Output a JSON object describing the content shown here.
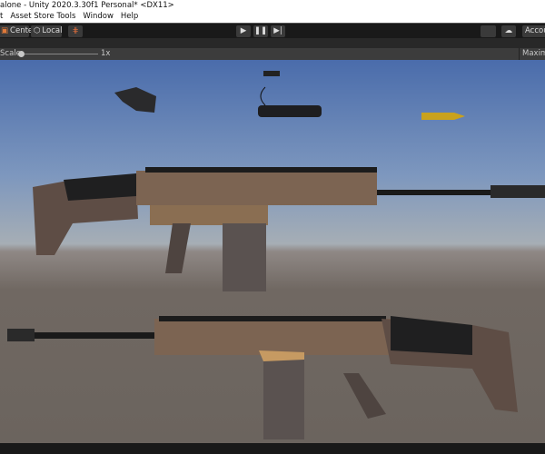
{
  "window": {
    "title": "alone - Unity 2020.3.30f1 Personal* <DX11>"
  },
  "menu": [
    "t",
    "Asset Store Tools",
    "Window",
    "Help"
  ],
  "toolbar": {
    "center": "Center",
    "local": "Local",
    "account": "Accou"
  },
  "game": {
    "scale_label": "Scale",
    "scale_value": "1x",
    "maximize": "Maximiz",
    "scale_fraction": 0.0
  }
}
